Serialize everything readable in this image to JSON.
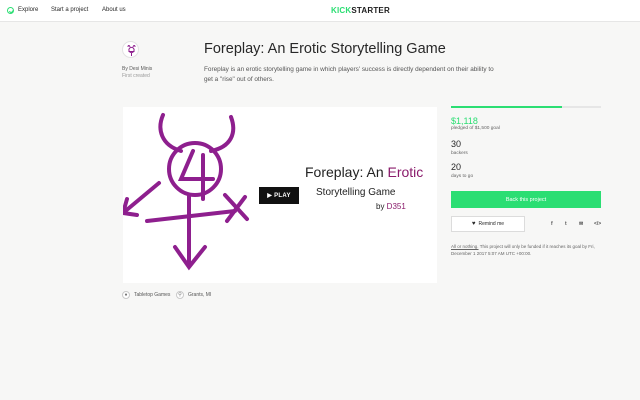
{
  "nav": {
    "explore": "Explore",
    "start": "Start a project",
    "about": "About us",
    "logo_a": "KICK",
    "logo_b": "STARTER"
  },
  "project": {
    "title": "Foreplay: An Erotic Storytelling Game",
    "blurb": "Foreplay is an erotic storytelling game in which players' success is directly dependent on their ability to get a \"rise\" out of others.",
    "creator_by": "By Desi Minis",
    "creator_status": "First created"
  },
  "video": {
    "title_a": "Foreplay:",
    "title_b": " An ",
    "title_c": "Erotic",
    "title_line2": "Storytelling Game",
    "by": "by ",
    "author": "D351",
    "play_label": "▶ PLAY"
  },
  "tags": {
    "category": "Tabletop Games",
    "location": "Grants, MI"
  },
  "stats": {
    "progress_percent": 74,
    "pledged": "$1,118",
    "pledged_of": "pledged of $1,500 goal",
    "backers": "30",
    "backers_label": "backers",
    "days": "20",
    "days_label": "days to go"
  },
  "actions": {
    "back_label": "Back this project",
    "remind_label": "Remind me",
    "share_fb": "f",
    "share_tw": "t",
    "share_mail": "✉",
    "share_embed": "</>"
  },
  "terms": {
    "link": "All or nothing.",
    "text": " This project will only be funded if it reaches its goal by Fri, December 1 2017 5:07 AM UTC +00:00."
  },
  "colors": {
    "accent": "#2bde73",
    "logo_purple": "#8a1b6b",
    "symbol_purple": "#8e1f8e"
  }
}
